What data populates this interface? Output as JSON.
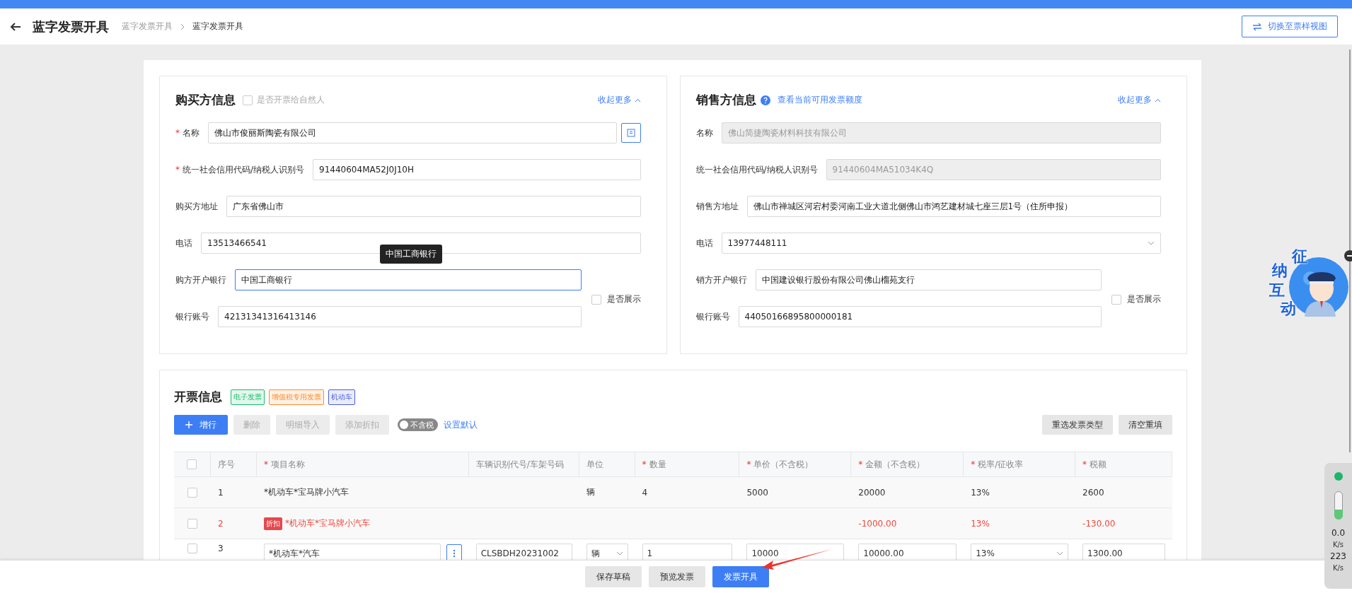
{
  "header": {
    "title": "蓝字发票开具",
    "breadcrumb": [
      {
        "label": "蓝字发票开具",
        "current": false
      },
      {
        "label": "蓝字发票开具",
        "current": true
      }
    ],
    "switch_button": "切换至票样视图"
  },
  "buyer": {
    "title": "购买方信息",
    "natural_person": {
      "label": "是否开票给自然人",
      "checked": false
    },
    "collapse_link": "收起更多",
    "fields": [
      {
        "label": "名称",
        "required_mark": "*",
        "value": "佛山市俊丽斯陶瓷有限公司",
        "kind": "lookup",
        "focused": false
      },
      {
        "label": "统一社会信用代码/纳税人识别号",
        "required_mark": "*",
        "value": "91440604MA52J0J10H",
        "kind": "input",
        "focused": false
      },
      {
        "label": "购买方地址",
        "value": "广东省佛山市",
        "kind": "input",
        "focused": false
      },
      {
        "label": "电话",
        "value": "13513466541",
        "kind": "input",
        "focused": false
      },
      {
        "label": "购方开户银行",
        "value": "中国工商银行",
        "kind": "short",
        "focused": true
      },
      {
        "label": "银行账号",
        "value": "42131341316413146",
        "kind": "short",
        "focused": false
      }
    ],
    "show_checkbox": {
      "label": "是否展示",
      "checked": false
    },
    "tooltip": "中国工商银行"
  },
  "seller": {
    "title": "销售方信息",
    "quota_link": "查看当前可用发票额度",
    "collapse_link": "收起更多",
    "fields": [
      {
        "label": "名称",
        "value": "佛山简捷陶瓷材料科技有限公司",
        "kind": "input",
        "disabled": true
      },
      {
        "label": "统一社会信用代码/纳税人识别号",
        "value": "91440604MA51034K4Q",
        "kind": "input",
        "disabled": true
      },
      {
        "label": "销售方地址",
        "value": "佛山市禅城区河宕村委河南工业大道北侧佛山市鸿艺建材城七座三层1号（住所申报）",
        "kind": "input",
        "disabled": false
      },
      {
        "label": "电话",
        "value": "13977448111",
        "kind": "select",
        "disabled": false
      },
      {
        "label": "销方开户银行",
        "value": "中国建设银行股份有限公司佛山榴苑支行",
        "kind": "short",
        "disabled": false
      },
      {
        "label": "银行账号",
        "value": "44050166895800000181",
        "kind": "short",
        "disabled": false
      }
    ],
    "show_checkbox": {
      "label": "是否展示",
      "checked": false
    }
  },
  "invoice": {
    "title": "开票信息",
    "tags": [
      {
        "label": "电子发票",
        "color": "#19be6b"
      },
      {
        "label": "增值税专用发票",
        "color": "#ff8c2a"
      },
      {
        "label": "机动车",
        "color": "#4a5fd8"
      }
    ],
    "toolbar": [
      {
        "label": "增行",
        "kind": "primary"
      },
      {
        "label": "删除",
        "kind": "disabled"
      },
      {
        "label": "明细导入",
        "kind": "disabled"
      },
      {
        "label": "添加折扣",
        "kind": "disabled"
      }
    ],
    "tax_toggle": {
      "label": "不含税",
      "on": false
    },
    "default_link": "设置默认",
    "right_buttons": [
      "重选发票类型",
      "清空重填"
    ],
    "select_all": {
      "checked": false
    },
    "columns": [
      {
        "label": "序号"
      },
      {
        "required_mark": "*",
        "label": "项目名称"
      },
      {
        "label": "车辆识别代号/车架号码"
      },
      {
        "label": "单位"
      },
      {
        "required_mark": "*",
        "label": "数量"
      },
      {
        "required_mark": "*",
        "label": "单价（不含税）"
      },
      {
        "required_mark": "*",
        "label": "金额（不含税）"
      },
      {
        "required_mark": "*",
        "label": "税率/征收率"
      },
      {
        "required_mark": "*",
        "label": "税额"
      }
    ],
    "rows": [
      {
        "kind": "plain",
        "checked": false,
        "cells": [
          "1",
          "*机动车*宝马牌小汽车",
          "",
          "辆",
          "4",
          "5000",
          "20000",
          "13%",
          "2600"
        ]
      },
      {
        "kind": "discount",
        "checked": false,
        "badge": "折扣",
        "cells": [
          "2",
          "*机动车*宝马牌小汽车",
          "",
          "",
          "",
          "",
          "-1000.00",
          "13%",
          "-130.00"
        ]
      },
      {
        "kind": "edit",
        "checked": false,
        "cells": [
          "3",
          "*机动车*汽车",
          "CLSBDH20231002",
          "辆",
          "1",
          "10000",
          "10000.00",
          "13%",
          "1300.00"
        ]
      }
    ]
  },
  "footer": {
    "buttons": [
      {
        "label": "保存草稿",
        "primary": false
      },
      {
        "label": "预览发票",
        "primary": false
      },
      {
        "label": "发票开具",
        "primary": true
      }
    ]
  },
  "assistant_widget": {
    "title": "征纳互动"
  },
  "speed_widget": {
    "upload": "0.0",
    "upload_unit": "K/s",
    "download": "223",
    "download_unit": "K/s"
  }
}
